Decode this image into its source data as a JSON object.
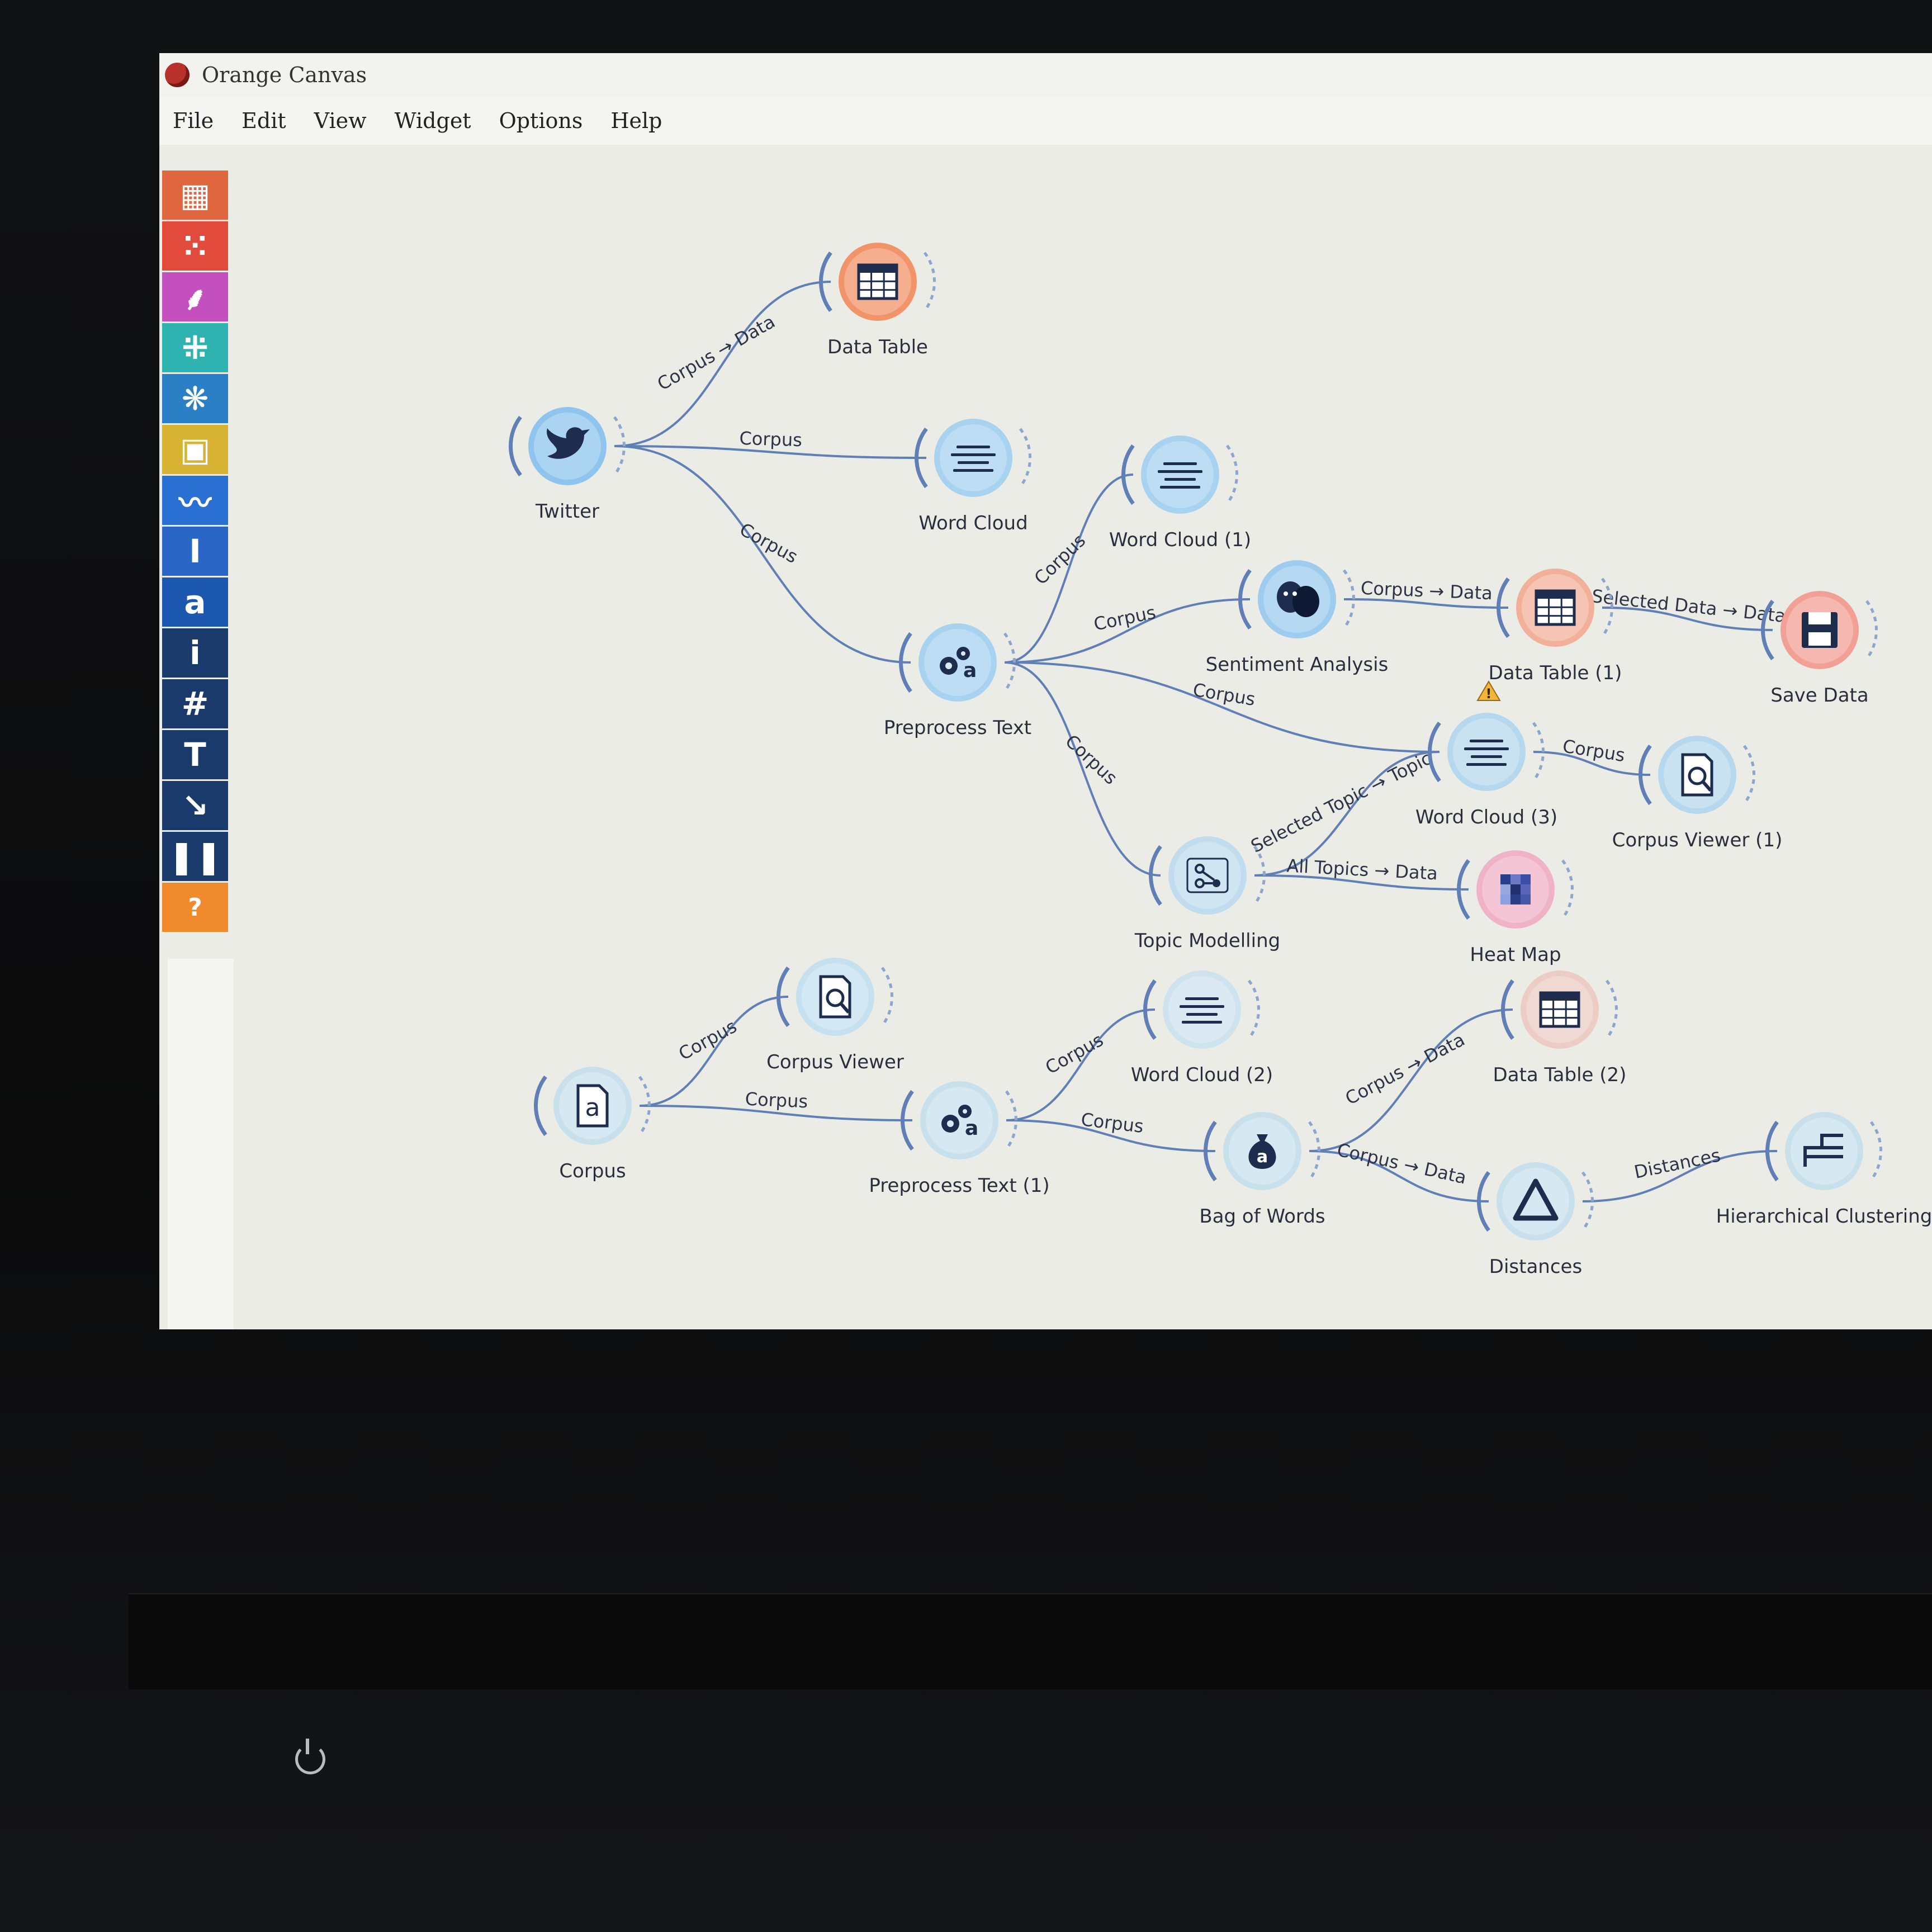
{
  "window": {
    "title": "Orange Canvas",
    "menu": [
      "File",
      "Edit",
      "View",
      "Widget",
      "Options",
      "Help"
    ]
  },
  "toolbox": [
    {
      "icon": "table-icon",
      "color": "#e0663f"
    },
    {
      "icon": "scatter-icon",
      "color": "#e24b3c"
    },
    {
      "icon": "tree-icon",
      "color": "#c44fbf"
    },
    {
      "icon": "grid-icon",
      "color": "#2fb3b0"
    },
    {
      "icon": "cluster-icon",
      "color": "#2b7fc4"
    },
    {
      "icon": "image-icon",
      "color": "#d8b233"
    },
    {
      "icon": "timeseries-icon",
      "color": "#2a6fd2"
    },
    {
      "icon": "text-cursor-icon",
      "color": "#2a66c6"
    },
    {
      "icon": "text-a-icon",
      "color": "#1d58b0"
    },
    {
      "icon": "info-icon",
      "color": "#1a3a6b"
    },
    {
      "icon": "hash-icon",
      "color": "#1a3a6b"
    },
    {
      "icon": "text-T-icon",
      "color": "#1a3a6b"
    },
    {
      "icon": "arrow-icon",
      "color": "#1a3a6b"
    },
    {
      "icon": "pause-icon",
      "color": "#1a3a6b"
    },
    {
      "icon": "help-icon",
      "color": "#ef8a2d"
    }
  ],
  "widgets": [
    {
      "id": "twitter",
      "label": "Twitter",
      "icon": "twitter-bird-icon",
      "fill": "#8fc4ee"
    },
    {
      "id": "data-table",
      "label": "Data Table",
      "icon": "table-icon",
      "fill": "#f2946a"
    },
    {
      "id": "word-cloud",
      "label": "Word Cloud",
      "icon": "word-cloud-icon",
      "fill": "#a7d2f0"
    },
    {
      "id": "word-cloud-1",
      "label": "Word Cloud (1)",
      "icon": "word-cloud-icon",
      "fill": "#a7d2f0"
    },
    {
      "id": "preprocess-text",
      "label": "Preprocess Text",
      "icon": "gears-icon",
      "fill": "#a7d2f0"
    },
    {
      "id": "sentiment-analysis",
      "label": "Sentiment Analysis",
      "icon": "masks-icon",
      "fill": "#9dccee"
    },
    {
      "id": "data-table-1",
      "label": "Data Table (1)",
      "icon": "table-icon",
      "fill": "#f2b09a"
    },
    {
      "id": "save-data",
      "label": "Save Data",
      "icon": "floppy-icon",
      "fill": "#f2a096"
    },
    {
      "id": "word-cloud-3",
      "label": "Word Cloud (3)",
      "icon": "word-cloud-icon",
      "fill": "#b6d8ee"
    },
    {
      "id": "corpus-viewer-1",
      "label": "Corpus Viewer (1)",
      "icon": "corpus-viewer-icon",
      "fill": "#b6d8ee"
    },
    {
      "id": "topic-modelling",
      "label": "Topic Modelling",
      "icon": "topic-icon",
      "fill": "#c1dcee"
    },
    {
      "id": "heat-map",
      "label": "Heat Map",
      "icon": "heatmap-icon",
      "fill": "#f0b2c6"
    },
    {
      "id": "corpus-viewer",
      "label": "Corpus Viewer",
      "icon": "corpus-viewer-icon",
      "fill": "#c5e0ee"
    },
    {
      "id": "corpus",
      "label": "Corpus",
      "icon": "corpus-file-icon",
      "fill": "#c8e0ec"
    },
    {
      "id": "preprocess-text-1",
      "label": "Preprocess Text (1)",
      "icon": "gears-icon",
      "fill": "#c8e0ec"
    },
    {
      "id": "word-cloud-2",
      "label": "Word Cloud (2)",
      "icon": "word-cloud-icon",
      "fill": "#cfe3ee"
    },
    {
      "id": "data-table-2",
      "label": "Data Table (2)",
      "icon": "table-icon",
      "fill": "#ecccc5"
    },
    {
      "id": "bag-of-words",
      "label": "Bag of Words",
      "icon": "bag-icon",
      "fill": "#c8e0ec"
    },
    {
      "id": "distances",
      "label": "Distances",
      "icon": "delta-icon",
      "fill": "#c8e0ec"
    },
    {
      "id": "hierarchical-clustering",
      "label": "Hierarchical Clustering",
      "icon": "dendrogram-icon",
      "fill": "#c8e0ec"
    }
  ],
  "links": [
    {
      "from": "twitter",
      "to": "data-table",
      "label": "Corpus → Data"
    },
    {
      "from": "twitter",
      "to": "word-cloud",
      "label": "Corpus"
    },
    {
      "from": "twitter",
      "to": "preprocess-text",
      "label": "Corpus"
    },
    {
      "from": "preprocess-text",
      "to": "word-cloud-1",
      "label": "Corpus"
    },
    {
      "from": "preprocess-text",
      "to": "sentiment-analysis",
      "label": "Corpus"
    },
    {
      "from": "preprocess-text",
      "to": "word-cloud-3",
      "label": "Corpus"
    },
    {
      "from": "preprocess-text",
      "to": "topic-modelling",
      "label": "Corpus"
    },
    {
      "from": "sentiment-analysis",
      "to": "data-table-1",
      "label": "Corpus → Data"
    },
    {
      "from": "data-table-1",
      "to": "save-data",
      "label": "Selected Data → Data"
    },
    {
      "from": "word-cloud-3",
      "to": "corpus-viewer-1",
      "label": "Corpus"
    },
    {
      "from": "topic-modelling",
      "to": "word-cloud-3",
      "label": "Selected Topic → Topic"
    },
    {
      "from": "topic-modelling",
      "to": "heat-map",
      "label": "All Topics → Data"
    },
    {
      "from": "corpus",
      "to": "corpus-viewer",
      "label": "Corpus"
    },
    {
      "from": "corpus",
      "to": "preprocess-text-1",
      "label": "Corpus"
    },
    {
      "from": "preprocess-text-1",
      "to": "word-cloud-2",
      "label": "Corpus"
    },
    {
      "from": "preprocess-text-1",
      "to": "bag-of-words",
      "label": "Corpus"
    },
    {
      "from": "bag-of-words",
      "to": "data-table-2",
      "label": "Corpus → Data"
    },
    {
      "from": "bag-of-words",
      "to": "distances",
      "label": "Corpus → Data"
    },
    {
      "from": "distances",
      "to": "hierarchical-clustering",
      "label": "Distances"
    }
  ],
  "warnings": [
    "word-cloud-3"
  ]
}
